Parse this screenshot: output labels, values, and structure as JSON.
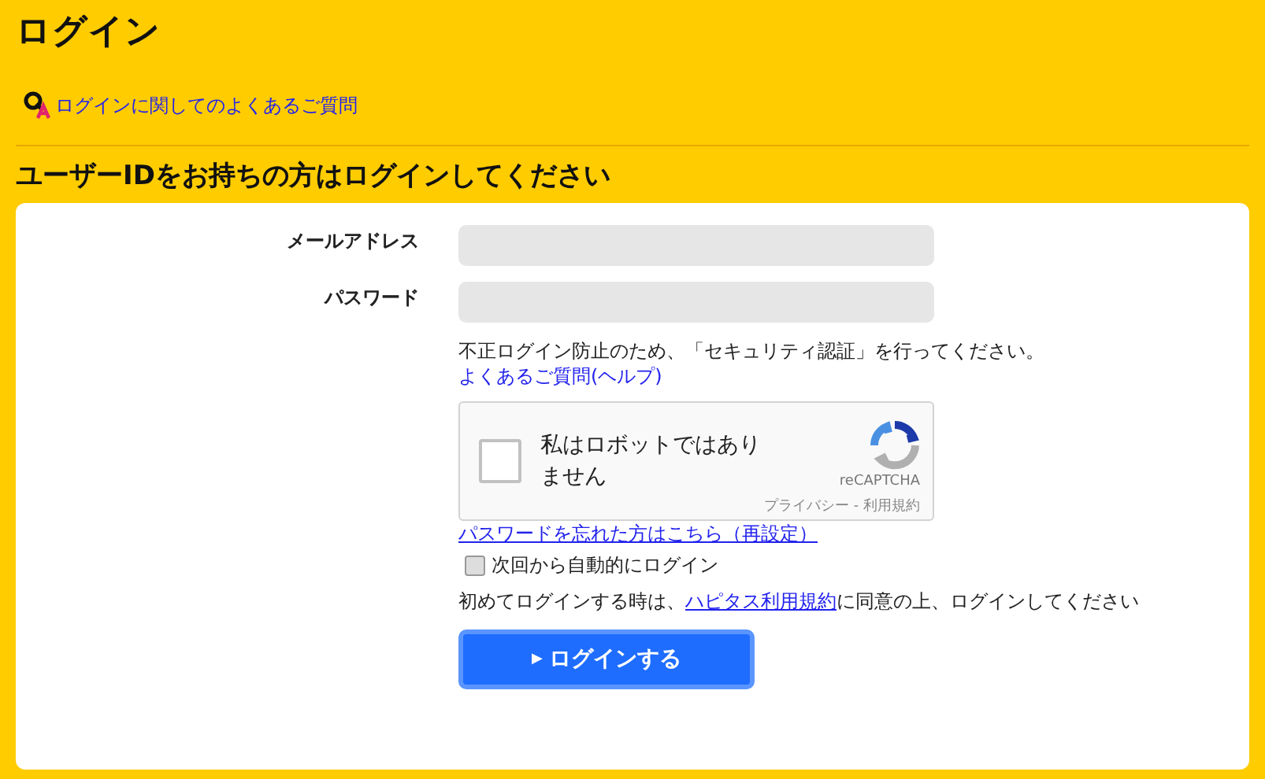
{
  "page": {
    "title": "ログイン",
    "faq_link": "ログインに関してのよくあるご質問"
  },
  "section": {
    "heading": "ユーザーIDをお持ちの方はログインしてください"
  },
  "form": {
    "fields": [
      {
        "label": "メールアドレス"
      },
      {
        "label": "パスワード"
      }
    ],
    "security_note": "不正ログイン防止のため、「セキュリティ認証」を行ってください。",
    "help_link": "よくあるご質問(ヘルプ)",
    "captcha": {
      "label": "私はロボットではありません",
      "checked": false,
      "brand": "reCAPTCHA",
      "footer": "プライバシー - 利用規約"
    },
    "forgot_link": "パスワードを忘れた方はこちら（再設定）",
    "auto_login": {
      "label": "次回から自動的にログイン",
      "checked": false
    },
    "terms": {
      "before": "初めてログインする時は、",
      "link": "ハピタス利用規約",
      "after": "に同意の上、ログインしてください"
    },
    "submit": {
      "icon": "▶",
      "label": "ログインする"
    }
  }
}
